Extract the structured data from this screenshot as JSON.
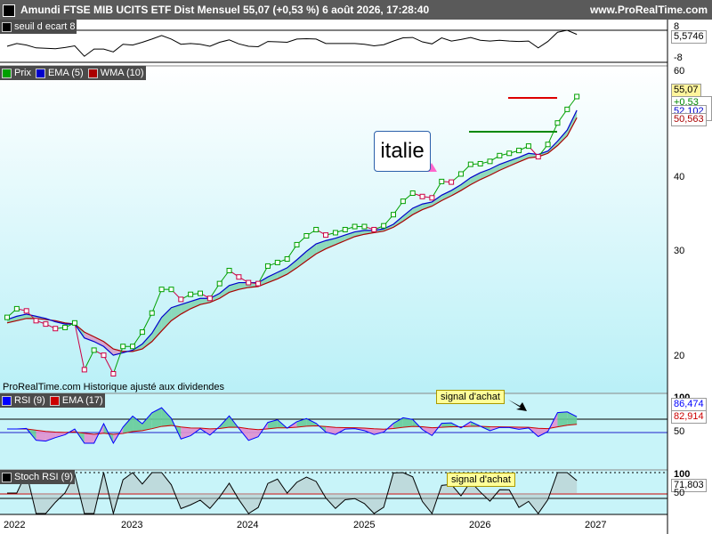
{
  "header": {
    "title": "Amundi FTSE MIB UCITS ETF Dist Mensuel 55,07 (+0,53 %) 6 août 2026, 17:28:40",
    "site": "www.ProRealTime.com"
  },
  "top_panel": {
    "legend": "seuil d ecart 8",
    "current_value": "5,5746",
    "ticks": [
      "8",
      "-8"
    ]
  },
  "main_panel": {
    "legend": [
      {
        "label": "Prix",
        "color": "#00a000"
      },
      {
        "label": "EMA (5)",
        "color": "#0000cc"
      },
      {
        "label": "WMA (10)",
        "color": "#aa0000"
      }
    ],
    "price_value": "55,07",
    "change_value": "+0,53 %",
    "ema_value": "52,102",
    "wma_value": "50,563",
    "annotation": "italie",
    "watermark": "ProRealTime.com Historique ajusté aux dividendes",
    "y_ticks": [
      "60",
      "40",
      "30",
      "20"
    ]
  },
  "rsi_panel": {
    "legend": [
      {
        "label": "RSI (9)",
        "color": "#0000ff"
      },
      {
        "label": "EMA (17)",
        "color": "#cc0000"
      }
    ],
    "rsi_value": "86,474",
    "ema_value": "82,914",
    "callout": "signal d'achat",
    "y_ticks": [
      "100",
      "50"
    ]
  },
  "stoch_panel": {
    "legend": "Stoch RSI (9)",
    "value": "71,803",
    "callout": "signal d'achat",
    "y_ticks": [
      "100",
      "50"
    ]
  },
  "x_axis": {
    "labels": [
      "2022",
      "2023",
      "2024",
      "2025",
      "2026",
      "2027"
    ]
  },
  "chart_data": {
    "type": "line",
    "x": [
      "2021-09",
      "2021-10",
      "2021-11",
      "2021-12",
      "2022-01",
      "2022-02",
      "2022-03",
      "2022-04",
      "2022-05",
      "2022-06",
      "2022-07",
      "2022-08",
      "2022-09",
      "2022-10",
      "2022-11",
      "2022-12",
      "2023-01",
      "2023-02",
      "2023-03",
      "2023-04",
      "2023-05",
      "2023-06",
      "2023-07",
      "2023-08",
      "2023-09",
      "2023-10",
      "2023-11",
      "2023-12",
      "2024-01",
      "2024-02",
      "2024-03",
      "2024-04",
      "2024-05",
      "2024-06",
      "2024-07",
      "2024-08",
      "2024-09",
      "2024-10",
      "2024-11",
      "2024-12",
      "2025-01",
      "2025-02",
      "2025-03",
      "2025-04",
      "2025-05",
      "2025-06",
      "2025-07",
      "2025-08",
      "2025-09",
      "2025-10",
      "2025-11",
      "2025-12",
      "2026-01",
      "2026-02",
      "2026-03",
      "2026-04",
      "2026-05",
      "2026-06",
      "2026-07",
      "2026-08"
    ],
    "series": [
      {
        "name": "Prix",
        "values": [
          22.6,
          23.4,
          23.2,
          22.3,
          22.0,
          21.6,
          21.7,
          22.1,
          18.3,
          19.8,
          19.4,
          18.0,
          20.1,
          20.1,
          21.3,
          23.0,
          25.3,
          25.3,
          24.3,
          24.8,
          24.9,
          24.4,
          25.9,
          27.3,
          26.6,
          26.0,
          25.9,
          27.8,
          28.2,
          28.6,
          30.3,
          31.4,
          32.2,
          31.5,
          31.8,
          32.2,
          32.6,
          32.6,
          32.2,
          32.7,
          34.2,
          36.1,
          37.3,
          36.8,
          36.6,
          39.1,
          39.0,
          40.3,
          41.9,
          42.0,
          42.4,
          43.4,
          43.8,
          44.3,
          45.1,
          43.2,
          45.4,
          49.5,
          52.3,
          55.07
        ]
      },
      {
        "name": "EMA (5)",
        "values": [
          22.4,
          22.7,
          22.9,
          22.7,
          22.5,
          22.2,
          22.0,
          22.0,
          20.8,
          20.5,
          20.1,
          19.4,
          19.6,
          19.8,
          20.3,
          21.2,
          22.6,
          23.5,
          23.8,
          24.1,
          24.4,
          24.4,
          24.9,
          25.7,
          26.0,
          26.0,
          26.0,
          26.6,
          27.1,
          27.6,
          28.5,
          29.5,
          30.4,
          30.8,
          31.1,
          31.5,
          31.9,
          32.1,
          32.1,
          32.3,
          32.9,
          34.0,
          35.1,
          35.7,
          36.0,
          37.0,
          37.7,
          38.6,
          39.7,
          40.5,
          41.1,
          41.9,
          42.5,
          43.1,
          43.8,
          43.6,
          44.2,
          46.0,
          48.1,
          52.102
        ]
      },
      {
        "name": "WMA (10)",
        "values": [
          22.1,
          22.3,
          22.5,
          22.5,
          22.4,
          22.3,
          22.1,
          22.0,
          21.3,
          20.9,
          20.5,
          19.9,
          19.7,
          19.7,
          19.9,
          20.5,
          21.4,
          22.3,
          22.9,
          23.4,
          23.8,
          24.0,
          24.4,
          25.0,
          25.3,
          25.5,
          25.6,
          26.0,
          26.4,
          26.9,
          27.6,
          28.4,
          29.2,
          29.8,
          30.3,
          30.8,
          31.3,
          31.6,
          31.8,
          32.0,
          32.5,
          33.3,
          34.2,
          34.9,
          35.4,
          36.2,
          36.9,
          37.7,
          38.6,
          39.4,
          40.1,
          40.9,
          41.6,
          42.3,
          43.0,
          43.2,
          43.8,
          45.2,
          47.0,
          50.563
        ]
      }
    ],
    "ylim": [
      18,
      61
    ],
    "yscale": "log",
    "grid": false,
    "legend_position": "top-left"
  }
}
